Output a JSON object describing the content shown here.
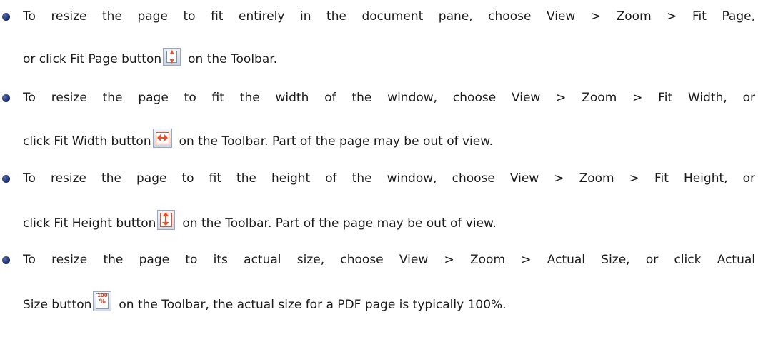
{
  "items": [
    {
      "line1": "To resize the page to fit entirely in the document pane, choose View > Zoom > Fit Page,",
      "line2_before": "or click Fit Page button",
      "icon": "fit-page-icon",
      "line2_after": "on the Toolbar."
    },
    {
      "line1": "To resize the page to fit the width of the window, choose View > Zoom > Fit Width, or",
      "line2_before": "click Fit Width button",
      "icon": "fit-width-icon",
      "line2_after": "on the Toolbar. Part of the page may be out of view."
    },
    {
      "line1": "To resize the page to fit the height of the window, choose View > Zoom > Fit Height, or",
      "line2_before": "click Fit Height button",
      "icon": "fit-height-icon",
      "line2_after": "on the Toolbar. Part of the page may be out of view."
    },
    {
      "line1": "To resize the page to its actual size, choose View > Zoom > Actual Size, or click Actual",
      "line2_before": "Size button",
      "icon": "actual-size-icon",
      "icon_text_top": "100",
      "icon_text_bottom": "%",
      "line2_after": "on the Toolbar, the actual size for a PDF page is typically 100%."
    }
  ],
  "colors": {
    "bullet": "#15246a",
    "icon_accent": "#e5502a",
    "text": "#1a1a1a"
  }
}
